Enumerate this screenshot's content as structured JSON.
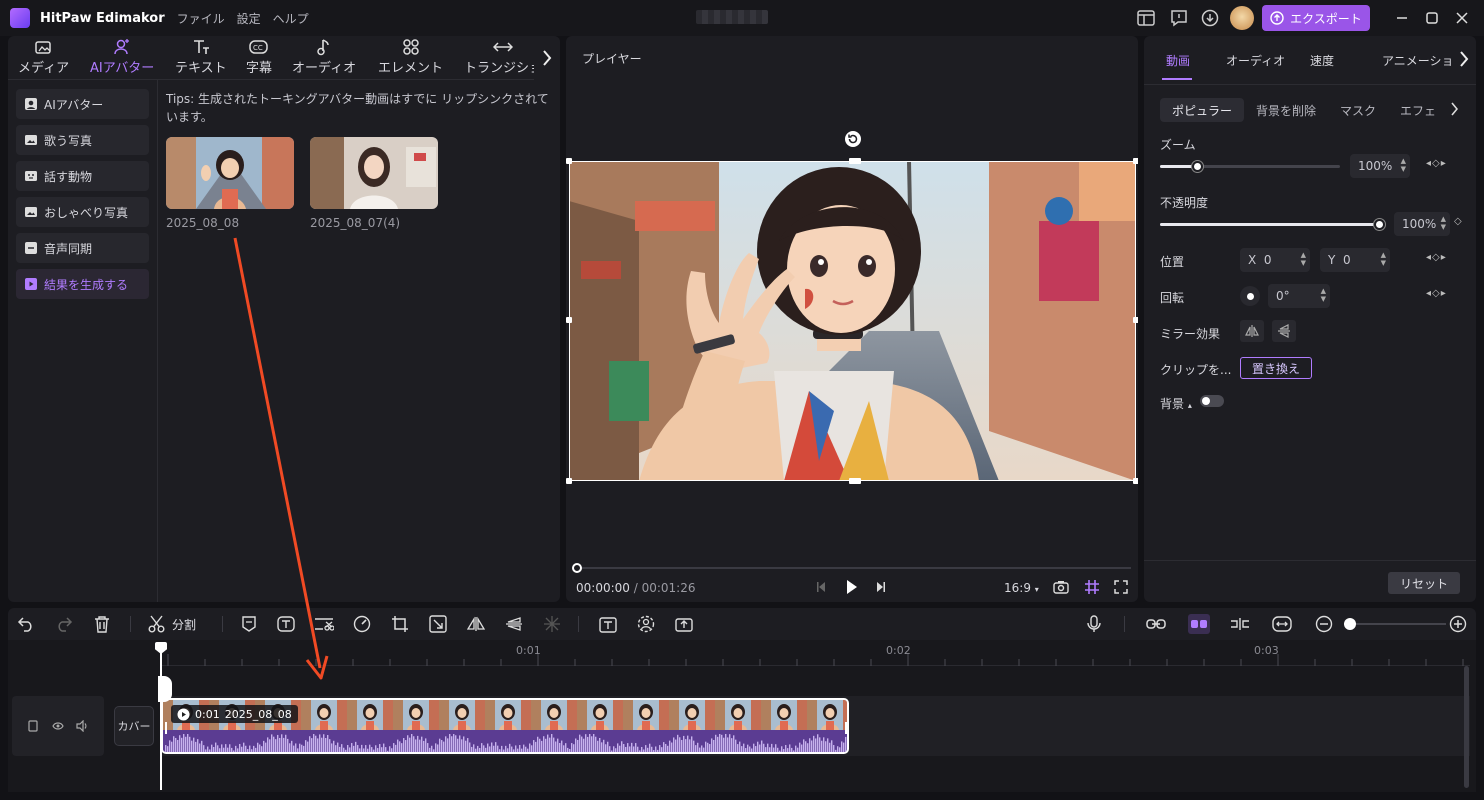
{
  "titlebar": {
    "app_name": "HitPaw Edimakor",
    "menus": [
      "ファイル",
      "設定",
      "ヘルプ"
    ],
    "export_label": "エクスポート"
  },
  "left": {
    "tabs": [
      {
        "label": "メディア"
      },
      {
        "label": "AIアバター"
      },
      {
        "label": "テキスト"
      },
      {
        "label": "字幕"
      },
      {
        "label": "オーディオ"
      },
      {
        "label": "エレメント"
      },
      {
        "label": "トランジショ"
      }
    ],
    "nav": [
      {
        "label": "AIアバター"
      },
      {
        "label": "歌う写真"
      },
      {
        "label": "話す動物"
      },
      {
        "label": "おしゃべり写真"
      },
      {
        "label": "音声同期"
      },
      {
        "label": "結果を生成する"
      }
    ],
    "tips": "Tips:  生成されたトーキングアバター動画はすでに リップシンクされています。",
    "thumbs": [
      {
        "name": "2025_08_08"
      },
      {
        "name": "2025_08_07(4)"
      }
    ]
  },
  "player": {
    "title": "プレイヤー",
    "current_time": "00:00:00",
    "separator": " / ",
    "total_time": "00:01:26",
    "ratio": "16:9"
  },
  "right": {
    "tabs": [
      "動画",
      "オーディオ",
      "速度",
      "アニメーショ"
    ],
    "subtabs": [
      "ポピュラー",
      "背景を削除",
      "マスク",
      "エフェ"
    ],
    "zoom_label": "ズーム",
    "zoom_value": "100%",
    "opacity_label": "不透明度",
    "opacity_value": "100%",
    "position_label": "位置",
    "pos_x_label": "X",
    "pos_x": "0",
    "pos_y_label": "Y",
    "pos_y": "0",
    "rotate_label": "回転",
    "rotate_value": "0°",
    "mirror_label": "ミラー効果",
    "clip_label": "クリップを...",
    "replace_label": "置き換え",
    "bg_label": "背景",
    "reset_label": "リセット"
  },
  "toolbar": {
    "split_label": "分割"
  },
  "timeline": {
    "ticks": [
      "0:01",
      "0:02",
      "0:03"
    ],
    "cover_label": "カバー",
    "clip_duration": "0:01",
    "clip_name": "2025_08_08"
  }
}
